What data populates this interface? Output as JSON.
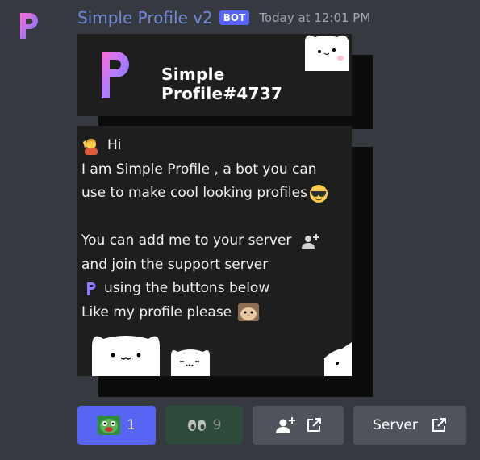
{
  "message": {
    "username": "Simple Profile v2",
    "badge": "BOT",
    "timestamp": "Today at 12:01 PM"
  },
  "embed": {
    "title_card": {
      "title": "Simple Profile#4737"
    },
    "body_card": {
      "lines": [
        "Hi",
        "I am Simple Profile , a bot you can",
        "use to make cool looking profiles",
        "",
        "You can add me to your server",
        "and join the support server",
        "using the buttons below",
        "Like my profile please"
      ]
    }
  },
  "buttons": {
    "reaction_count": "1",
    "eyes_count": "9",
    "server_label": "Server"
  },
  "colors": {
    "username": "#7289da",
    "bot_badge": "#5865f2",
    "primary_button": "#5865f2",
    "success_button": "#2d4a3a",
    "secondary_button": "#4f545c"
  },
  "icons": [
    "simple-profile-logo-icon",
    "cat-icon",
    "wave-emoji-icon",
    "sunglasses-emoji-icon",
    "add-user-icon",
    "hamster-emoji-icon",
    "pepe-emoji-icon",
    "eyes-emoji-icon",
    "external-link-icon"
  ]
}
